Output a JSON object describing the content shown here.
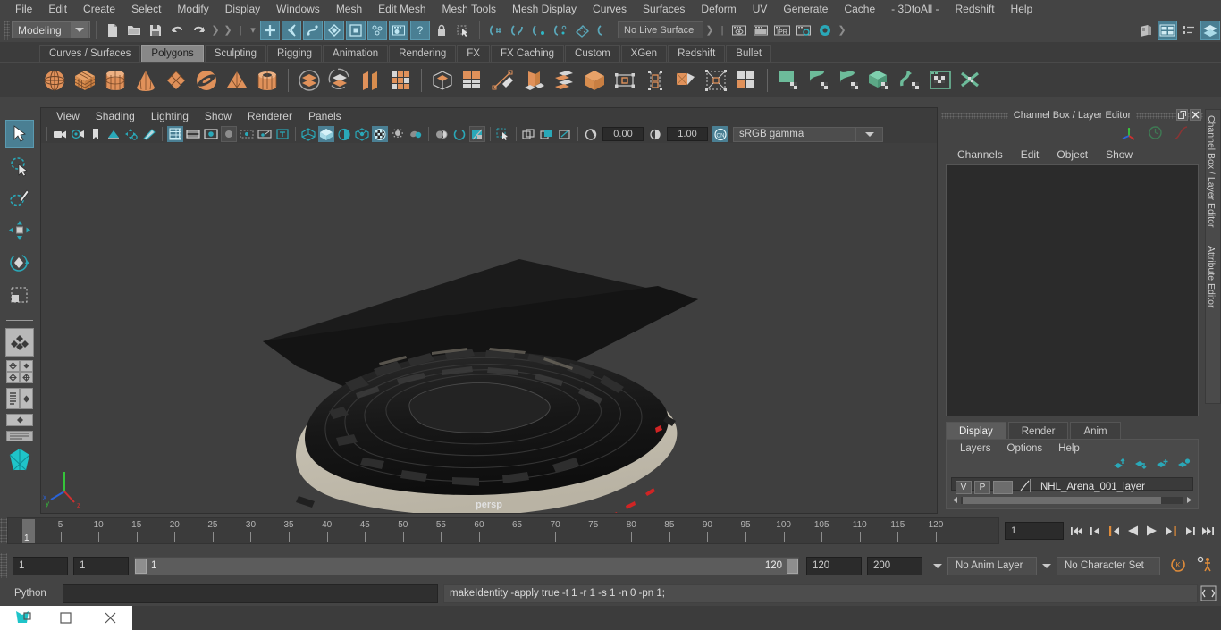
{
  "menubar": {
    "items": [
      "File",
      "Edit",
      "Create",
      "Select",
      "Modify",
      "Display",
      "Windows",
      "Mesh",
      "Edit Mesh",
      "Mesh Tools",
      "Mesh Display",
      "Curves",
      "Surfaces",
      "Deform",
      "UV",
      "Generate",
      "Cache",
      "- 3DtoAll -",
      "Redshift",
      "Help"
    ]
  },
  "status": {
    "mode": "Modeling",
    "live_surface": "No Live Surface",
    "icons": [
      "new-scene-icon",
      "open-scene-icon",
      "save-scene-icon",
      "undo-icon",
      "redo-icon",
      "select-by-hierarchy-icon",
      "select-by-object-icon",
      "select-by-component-icon",
      "select-hierarchy-icon",
      "select-object-icon",
      "select-component-icon",
      "select-render-icon",
      "select-help-icon",
      "lock-icon",
      "selection-mask-icon",
      "snap-to-grid-icon",
      "snap-to-curve-icon",
      "snap-to-point-icon",
      "snap-to-projected-icon",
      "snap-to-view-plane-icon",
      "make-live-icon",
      "render-view-icon",
      "render-current-frame-icon",
      "ipr-render-icon",
      "render-settings-icon",
      "hypershade-icon",
      "show-hide-editor-icon",
      "attribute-editor-icon",
      "tool-settings-icon",
      "channel-box-icon"
    ]
  },
  "shelf": {
    "tabs": [
      "Curves / Surfaces",
      "Polygons",
      "Sculpting",
      "Rigging",
      "Animation",
      "Rendering",
      "FX",
      "FX Caching",
      "Custom",
      "XGen",
      "Redshift",
      "Bullet"
    ],
    "active_tab": "Polygons",
    "icons": [
      "poly-sphere-icon",
      "poly-cube-icon",
      "poly-cylinder-icon",
      "poly-cone-icon",
      "poly-plane-icon",
      "poly-torus-icon",
      "poly-pyramid-icon",
      "poly-pipe-icon",
      "poly-combine-icon",
      "poly-separate-icon",
      "poly-extract-icon",
      "poly-booleans-icon",
      "poly-mirror-icon",
      "poly-smooth-icon",
      "poly-multicut-icon",
      "poly-extrude-icon",
      "poly-bevel-icon",
      "poly-bridge-icon",
      "poly-append-icon",
      "poly-wedge-icon",
      "poly-fill-hole-icon",
      "poly-circularize-icon",
      "poly-quad-draw-icon",
      "uv-editor-icon",
      "uv-planar-icon",
      "uv-cylindrical-icon",
      "uv-automatic-icon",
      "uv-unfold-icon",
      "uv-layout-icon",
      "uv-cut-sew-icon"
    ]
  },
  "toolbox": {
    "tools": [
      "select-tool",
      "lasso-select-tool",
      "paint-select-tool",
      "move-tool",
      "rotate-tool",
      "scale-tool",
      "last-tool-used",
      "poly-layout-quad-icon",
      "four-view-layout-icon",
      "persp-outliner-layout-icon",
      "persp-graph-layout-icon",
      "single-persp-layout-icon",
      "hypershade-layout-icon"
    ],
    "selected_tool": "select-tool"
  },
  "viewport": {
    "menu": [
      "View",
      "Shading",
      "Lighting",
      "Show",
      "Renderer",
      "Panels"
    ],
    "exposure": "0.00",
    "gamma_value": "1.00",
    "color_profile": "sRGB gamma",
    "view_label": "persp",
    "toolbar_icons": [
      "select-camera-icon",
      "lock-camera-icon",
      "bookmark-icon",
      "image-plane-icon",
      "2d-pan-zoom-icon",
      "oil-paint-icon",
      "grid-toggle-icon",
      "film-gate-icon",
      "resolution-gate-icon",
      "gate-mask-icon",
      "film-origin-icon",
      "safe-action-icon",
      "text-overlay-icon",
      "wireframe-icon",
      "smooth-shade-icon",
      "shaded-wireframe-icon",
      "textured-icon",
      "use-all-lights-icon",
      "shadows-icon",
      "ambient-occlusion-icon",
      "motion-blur-icon",
      "anti-alias-icon",
      "multisample-icon",
      "depth-of-field-icon",
      "isolate-select-icon",
      "xray-icon",
      "xray-joints-icon",
      "xray-active-components-icon",
      "exposure-icon",
      "gamma-icon",
      "color-management-on-icon"
    ]
  },
  "channelbox": {
    "panel_title": "Channel Box / Layer Editor",
    "menu": [
      "Channels",
      "Edit",
      "Object",
      "Show"
    ],
    "header_icons": [
      "axis-manipulator-icon",
      "clock-icon",
      "curve-icon"
    ],
    "window_buttons": [
      "undock-icon",
      "close-icon"
    ]
  },
  "layer_editor": {
    "tabs": [
      "Display",
      "Render",
      "Anim"
    ],
    "active_tab": "Display",
    "menu": [
      "Layers",
      "Options",
      "Help"
    ],
    "button_icons": [
      "move-layer-up-icon",
      "move-layer-down-icon",
      "new-layer-icon",
      "new-layer-from-selected-icon"
    ],
    "layers": [
      {
        "visible": "V",
        "playback": "P",
        "name": "NHL_Arena_001_layer"
      }
    ]
  },
  "dock_tabs": [
    "Channel Box / Layer Editor",
    "Attribute Editor"
  ],
  "timeline": {
    "ticks": [
      5,
      10,
      15,
      20,
      25,
      30,
      35,
      40,
      45,
      50,
      55,
      60,
      65,
      70,
      75,
      80,
      85,
      90,
      95,
      100,
      105,
      110,
      115,
      120
    ],
    "current_frame_marker": "1",
    "current_frame_field": "1",
    "playback_icons": [
      "go-to-start-icon",
      "step-back-keyframe-icon",
      "step-back-frame-icon",
      "play-backwards-icon",
      "play-forwards-icon",
      "step-forward-frame-icon",
      "step-forward-keyframe-icon",
      "go-to-end-icon"
    ]
  },
  "range": {
    "anim_start": "1",
    "range_start": "1",
    "slider_start_label": "1",
    "slider_end_label": "120",
    "range_end": "120",
    "anim_end": "200",
    "anim_layer": "No Anim Layer",
    "character_set": "No Character Set",
    "right_icons": [
      "auto-keyframe-icon",
      "animation-preferences-icon"
    ]
  },
  "command": {
    "label": "Python",
    "input_value": "",
    "output": "makeIdentity -apply true -t 1 -r 1 -s 1 -n 0 -pn 1;",
    "script_editor_icon": "script-editor-icon"
  },
  "taskbar": {
    "app_icon": "maya-app-icon",
    "buttons": [
      "restore-window-icon",
      "maximize-window-icon",
      "close-window-icon"
    ]
  },
  "colors": {
    "accent_blue": "#4a7f93",
    "shelf_orange": "#e0915a",
    "shelf_green": "#6dbb9a",
    "background": "#444444",
    "panel_dark": "#2b2b2b"
  }
}
